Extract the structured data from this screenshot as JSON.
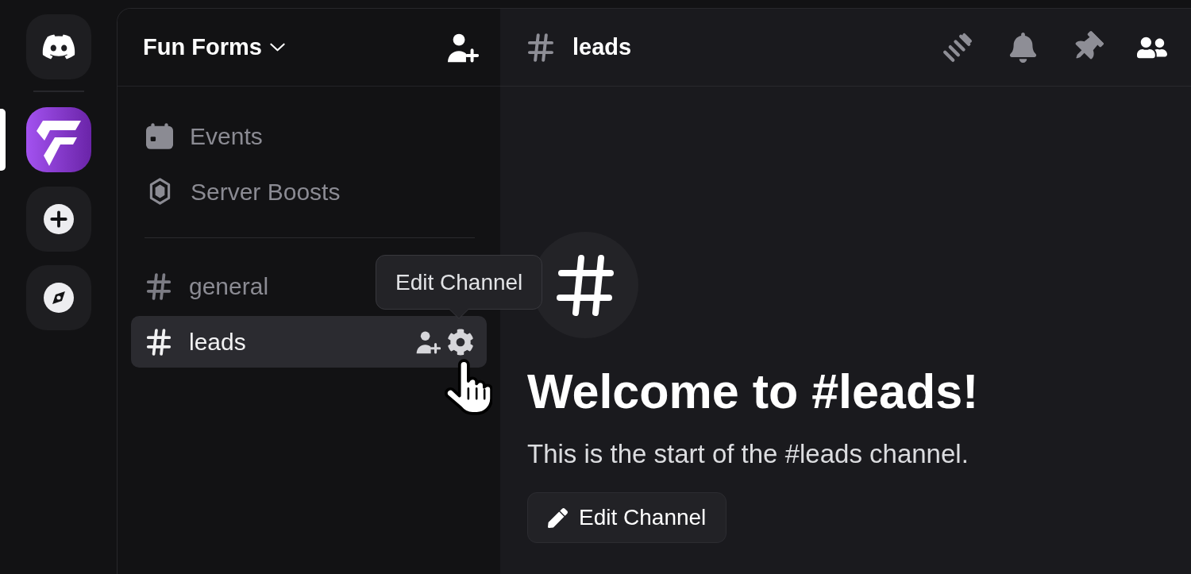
{
  "server_rail": {
    "items": [
      {
        "kind": "home",
        "selected": false
      },
      {
        "kind": "server",
        "selected": true
      },
      {
        "kind": "add",
        "selected": false
      },
      {
        "kind": "discover",
        "selected": false
      }
    ]
  },
  "channel_sidebar": {
    "server_name": "Fun Forms",
    "shortcuts": [
      {
        "kind": "events",
        "label": "Events"
      },
      {
        "kind": "boosts",
        "label": "Server Boosts"
      }
    ],
    "channels": [
      {
        "name": "general",
        "selected": false
      },
      {
        "name": "leads",
        "selected": true
      }
    ]
  },
  "tooltip": {
    "text": "Edit Channel"
  },
  "channel_header": {
    "name": "leads"
  },
  "welcome": {
    "title": "Welcome to #leads!",
    "text": "This is the start of the #leads channel.",
    "button": "Edit Channel"
  }
}
